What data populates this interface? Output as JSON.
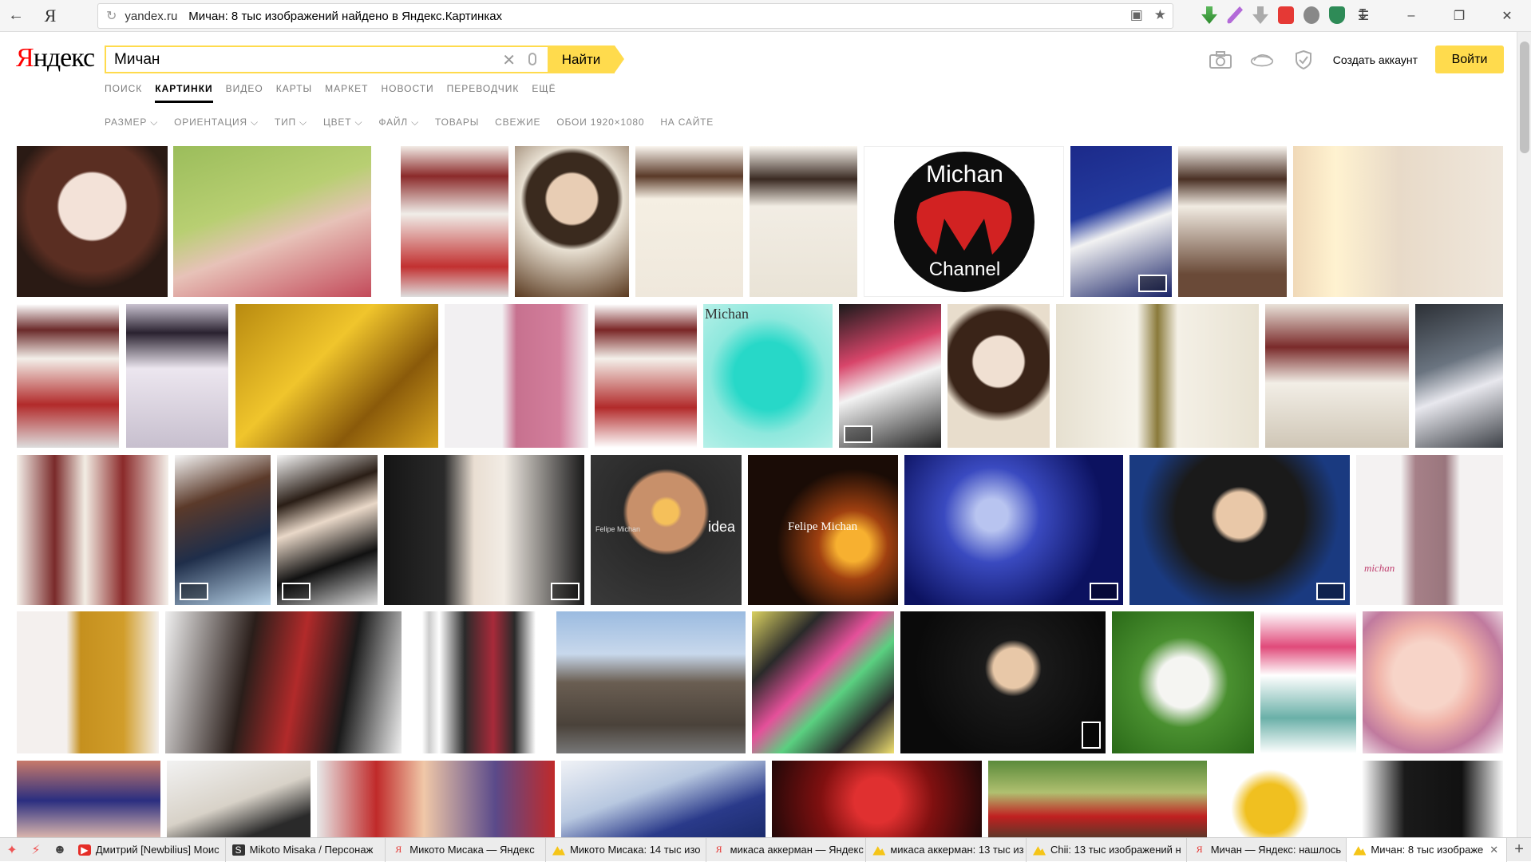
{
  "browser": {
    "tab_icon_text": "Я",
    "domain": "yandex.ru",
    "page_title": "Мичан: 8 тыс изображений найдено в Яндекс.Картинках"
  },
  "header": {
    "logo_first": "Я",
    "logo_rest": "ндекс",
    "search_value": "Мичан",
    "search_button": "Найти",
    "create_account": "Создать аккаунт",
    "login": "Войти"
  },
  "tabs": [
    {
      "label": "ПОИСК",
      "active": false
    },
    {
      "label": "КАРТИНКИ",
      "active": true
    },
    {
      "label": "ВИДЕО",
      "active": false
    },
    {
      "label": "КАРТЫ",
      "active": false
    },
    {
      "label": "МАРКЕТ",
      "active": false
    },
    {
      "label": "НОВОСТИ",
      "active": false
    },
    {
      "label": "ПЕРЕВОДЧИК",
      "active": false
    },
    {
      "label": "ЕЩЁ",
      "active": false
    }
  ],
  "filters": [
    "РАЗМЕР ⌵",
    "ОРИЕНТАЦИЯ ⌵",
    "ТИП ⌵",
    "ЦВЕТ ⌵",
    "ФАЙЛ ⌵",
    "ТОВАРЫ",
    "СВЕЖИЕ",
    "ОБОИ 1920×1080",
    "НА САЙТЕ"
  ],
  "michan_logo": {
    "top": "Michan",
    "bottom": "Channel"
  },
  "image_labels": {
    "felipe": "Felipe Michan",
    "idea": "idea",
    "felipe2": "Felipe Michan",
    "michan_anime": "Michan",
    "michan_dress": "michan"
  },
  "colors": {
    "accent": "#ffdb4d",
    "logo_red": "#ff0000"
  },
  "taskbar": {
    "tabs": [
      {
        "favicon": "youtube-favicon",
        "label": "Дмитрий [Newbilius] Моис"
      },
      {
        "favicon": "s-favicon",
        "label": "Mikoto Misaka / Персонаж"
      },
      {
        "favicon": "yandex-favicon",
        "label": "Микото Мисака — Яндекс"
      },
      {
        "favicon": "yandex-images-favicon",
        "label": "Микото Мисака: 14 тыс изо"
      },
      {
        "favicon": "yandex-favicon",
        "label": "микаса аккерман — Яндекс"
      },
      {
        "favicon": "yandex-images-favicon",
        "label": "микаса аккерман: 13 тыс из"
      },
      {
        "favicon": "yandex-images-favicon",
        "label": "Chii: 13 тыс изображений н"
      },
      {
        "favicon": "yandex-favicon",
        "label": "Мичан — Яндекс: нашлось"
      },
      {
        "favicon": "yandex-images-favicon",
        "label": "Мичан: 8 тыс изображе"
      }
    ]
  }
}
